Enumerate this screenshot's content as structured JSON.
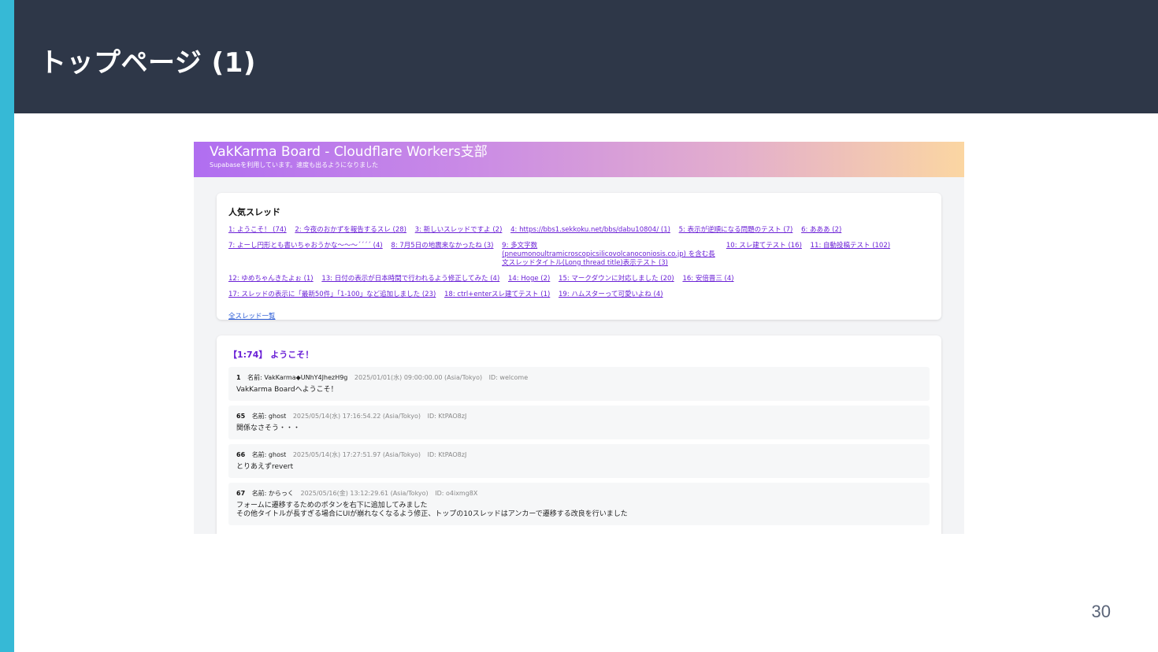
{
  "slide": {
    "title": "トップページ (1)",
    "page_number": "30",
    "colors": {
      "header_bg": "#2e3748",
      "accent": "#36b9d6"
    }
  },
  "site": {
    "title": "VakKarma Board - Cloudflare Workers支部",
    "subtitle": "Supabaseを利用しています。速度も出るようになりました"
  },
  "popular": {
    "heading": "人気スレッド",
    "rows": [
      [
        "1: ようこそ！ (74)",
        "2: 今夜のおかずを報告するスレ (28)",
        "3: 新しいスレッドですよ (2)",
        "4: https://bbs1.sekkoku.net/bbs/dabu10804/ (1)",
        "5: 表示が逆順になる問題のテスト (7)",
        "6: あああ (2)"
      ],
      [
        "7: よーし円形とも書いちゃおうかな〜〜〜´´´´ (4)",
        "8: 7月5日の地震来なかったね (3)",
        "9: 多文字数(pneumonoultramicroscopicsilicovolcanoconiosis.co.jp) を含む長文スレッドタイトル(Long thread title)表示テスト (3)",
        "10: スレ建てテスト (16)",
        "11: 自動投稿テスト (102)"
      ],
      [
        "12: ゆめちゃんきたよぉ (1)",
        "13: 日付の表示が日本時間で行われるよう修正してみた (4)",
        "14: Hoge (2)",
        "15: マークダウンに対応しました (20)",
        "16: 安倍晋三 (4)"
      ],
      [
        "17: スレッドの表示に「最新50件」「1-100」など追加しました (23)",
        "18: ctrl+enterスレ建てテスト (1)",
        "19: ハムスターって可愛いよね (4)"
      ]
    ],
    "all_threads_label": "全スレッド一覧"
  },
  "thread": {
    "title": "【1:74】 ようこそ！",
    "posts": [
      {
        "num": "1",
        "name": "名前: VakKarma◆UNhY4JhezH9g",
        "date": "2025/01/01(水) 09:00:00.00 (Asia/Tokyo)",
        "id": "ID: welcome",
        "body": "VakKarma Boardへようこそ！"
      },
      {
        "num": "65",
        "name": "名前: ghost",
        "date": "2025/05/14(水) 17:16:54.22 (Asia/Tokyo)",
        "id": "ID: KtPAO8zJ",
        "body": "関係なさそう・・・"
      },
      {
        "num": "66",
        "name": "名前: ghost",
        "date": "2025/05/14(水) 17:27:51.97 (Asia/Tokyo)",
        "id": "ID: KtPAO8zJ",
        "body": "とりあえずrevert"
      },
      {
        "num": "67",
        "name": "名前: からっく",
        "date": "2025/05/16(金) 13:12:29.61 (Asia/Tokyo)",
        "id": "ID: o4ixmg8X",
        "body": "フォームに遷移するためのボタンを右下に追加してみました\nその他タイトルが長すぎる場合にUIが崩れなくなるよう修正、トップの10スレッドはアンカーで遷移する改良を行いました"
      }
    ]
  }
}
